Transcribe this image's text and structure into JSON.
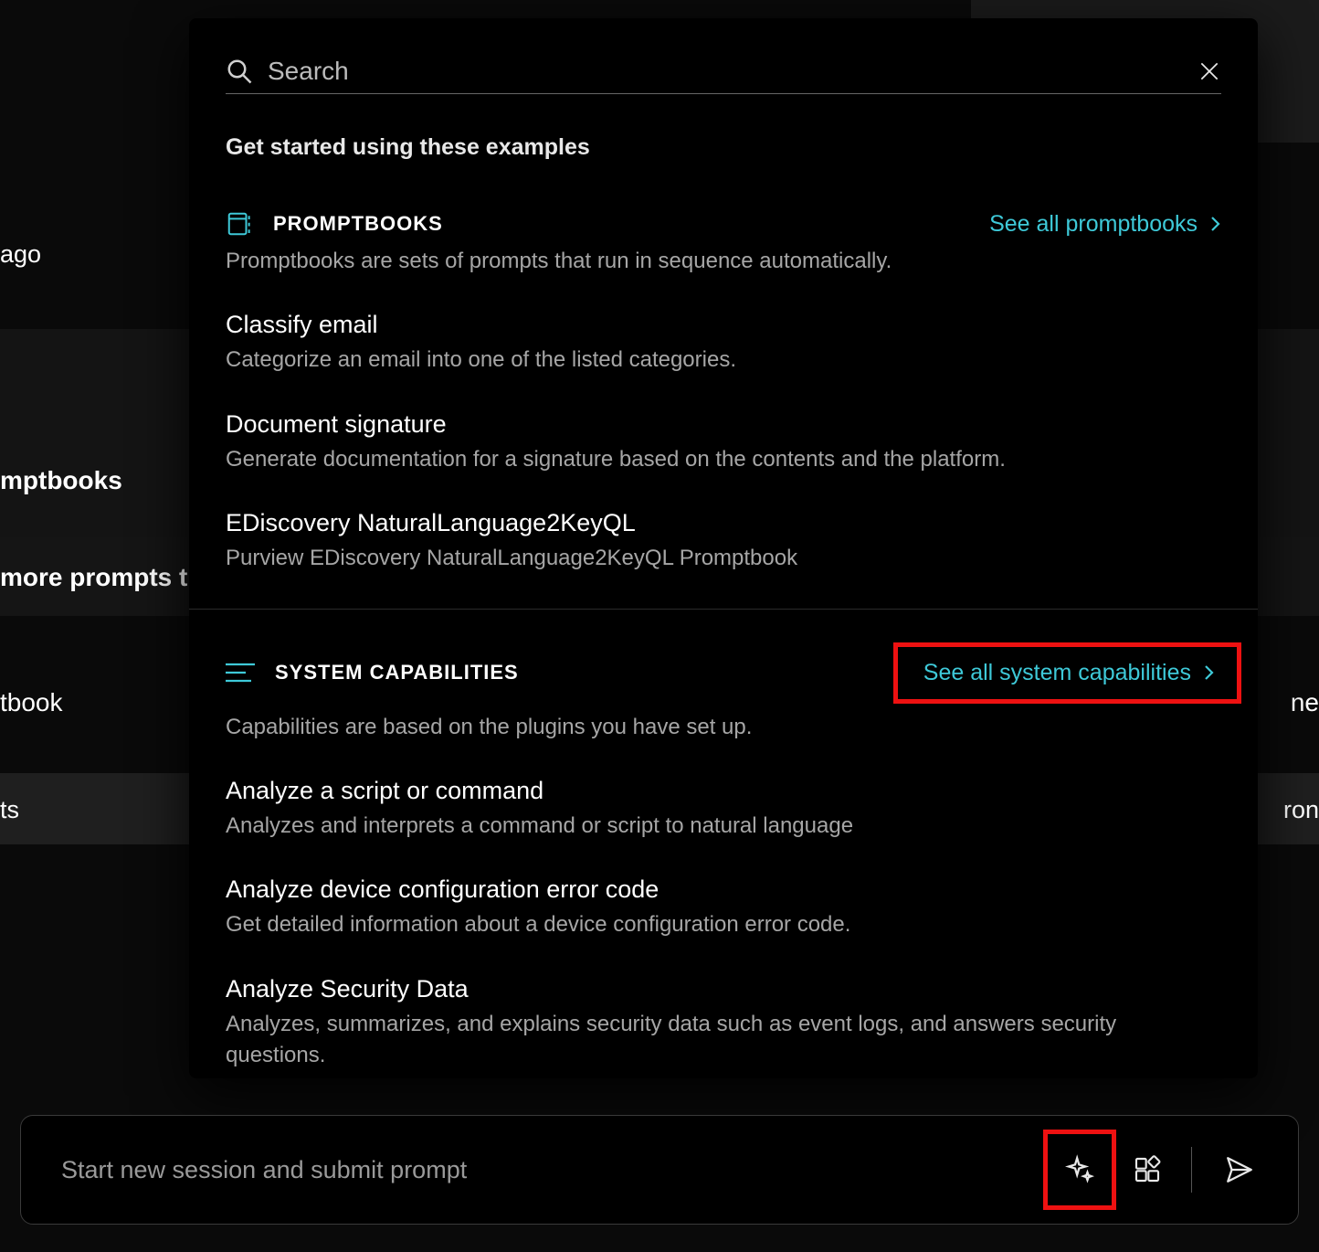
{
  "background": {
    "ago": "ago",
    "mptbooks": "mptbooks",
    "more_prompts": " more prompts tl",
    "tbook": "tbook",
    "ts": "ts",
    "right_ne": "ne",
    "right_ron": "ron"
  },
  "search": {
    "placeholder": "Search"
  },
  "tagline": "Get started using these examples",
  "promptbooks": {
    "heading": "PROMPTBOOKS",
    "see_all": "See all promptbooks",
    "description": "Promptbooks are sets of prompts that run in sequence automatically.",
    "items": [
      {
        "title": "Classify email",
        "desc": "Categorize an email into one of the listed categories."
      },
      {
        "title": "Document signature",
        "desc": "Generate documentation for a signature based on the contents and the platform."
      },
      {
        "title": "EDiscovery NaturalLanguage2KeyQL",
        "desc": "Purview EDiscovery NaturalLanguage2KeyQL Promptbook"
      }
    ]
  },
  "capabilities": {
    "heading": "SYSTEM CAPABILITIES",
    "see_all": "See all system capabilities",
    "description": "Capabilities are based on the plugins you have set up.",
    "items": [
      {
        "title": "Analyze a script or command",
        "desc": "Analyzes and interprets a command or script to natural language"
      },
      {
        "title": "Analyze device configuration error code",
        "desc": "Get detailed information about a device configuration error code."
      },
      {
        "title": "Analyze Security Data",
        "desc": "Analyzes, summarizes, and explains security data such as event logs, and answers security questions."
      }
    ]
  },
  "promptBar": {
    "placeholder": "Start new session and submit prompt"
  },
  "colors": {
    "accent": "#3ec9d8",
    "highlight_border": "#e11"
  }
}
